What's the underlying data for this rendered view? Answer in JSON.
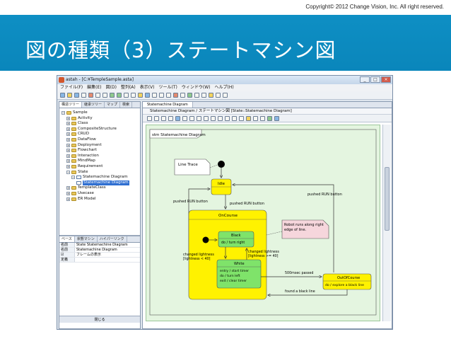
{
  "slide": {
    "copyright": "Copyright© 2012 Change Vision, Inc. All right reserved.",
    "title": "図の種類（3）ステートマシン図"
  },
  "window": {
    "title": "astah - [C:¥TempleSample.asta]",
    "controls": [
      "_",
      "□",
      "×"
    ],
    "menu": [
      "ファイル(F)",
      "編集(E)",
      "図(D)",
      "整列(A)",
      "表示(V)",
      "ツール(T)",
      "ウィンドウ(W)",
      "ヘルプ(H)"
    ]
  },
  "left_panel": {
    "tabs": [
      "構造ツリー",
      "継承ツリー",
      "マップ",
      "検索"
    ],
    "tree": [
      {
        "label": "Sample",
        "depth": 0,
        "icon": "project-icon",
        "expander": "−"
      },
      {
        "label": "Activity",
        "depth": 1,
        "icon": "folder-icon",
        "expander": "+"
      },
      {
        "label": "Class",
        "depth": 1,
        "icon": "folder-icon",
        "expander": "+"
      },
      {
        "label": "CompositeStructure",
        "depth": 1,
        "icon": "folder-icon",
        "expander": "+"
      },
      {
        "label": "CRUD",
        "depth": 1,
        "icon": "folder-icon",
        "expander": "+"
      },
      {
        "label": "DataFlow",
        "depth": 1,
        "icon": "folder-icon",
        "expander": "+"
      },
      {
        "label": "Deployment",
        "depth": 1,
        "icon": "folder-icon",
        "expander": "+"
      },
      {
        "label": "Flowchart",
        "depth": 1,
        "icon": "folder-icon",
        "expander": "+"
      },
      {
        "label": "Interaction",
        "depth": 1,
        "icon": "folder-icon",
        "expander": "+"
      },
      {
        "label": "MindMap",
        "depth": 1,
        "icon": "folder-icon",
        "expander": "+"
      },
      {
        "label": "Requirement",
        "depth": 1,
        "icon": "folder-icon",
        "expander": "+"
      },
      {
        "label": "State",
        "depth": 1,
        "icon": "folder-icon",
        "expander": "−"
      },
      {
        "label": "Statemachine Diagram",
        "depth": 2,
        "icon": "diagram-icon",
        "expander": "−"
      },
      {
        "label": "Statemachine Diagram",
        "depth": 3,
        "icon": "diagram-icon",
        "expander": "",
        "selected": true
      },
      {
        "label": "TemplateClass",
        "depth": 1,
        "icon": "folder-icon",
        "expander": "+"
      },
      {
        "label": "Usecase",
        "depth": 1,
        "icon": "folder-icon",
        "expander": "+"
      },
      {
        "label": "ER Model",
        "depth": 1,
        "icon": "folder-icon",
        "expander": "+"
      }
    ],
    "prop_tabs": [
      "ベース",
      "状態マシン",
      "ハイパーリンク"
    ],
    "props": [
      {
        "key": "名前",
        "value": "State Statemachine Diagram"
      },
      {
        "key": "名前",
        "value": "Statemachine Diagram"
      },
      {
        "key": "☑",
        "value": "フレームの表示"
      },
      {
        "key": "定義",
        "value": ""
      }
    ],
    "footer": "閉じる"
  },
  "diagram": {
    "tab": "Statemachine Diagram",
    "title": "Statemachine Diagram / ステートマシン図 [State::Statemachine Diagram]",
    "frame_label": "stm Statemachine Diagram",
    "note_line_trace": "Line Trace",
    "note_robot": [
      "Robot runs along right",
      "edge of line."
    ],
    "states": {
      "idle": "Idle",
      "oncourse": "OnCourse",
      "black": "Black",
      "black_action": "do / turn right",
      "white": "White",
      "white_actions": [
        "entry / start timer",
        "do / turn left",
        "exit / clear timer"
      ],
      "outofcourse": "OutOfCourse",
      "outofcourse_action": "do / explore a black line"
    },
    "transitions": {
      "pushed_run_right": "pushed RUN button",
      "pushed_run_left": "pushed RUN button",
      "pushed_run_mid": "pushed RUN button",
      "changed_left": [
        "changed lightness",
        "[lightness < 40]"
      ],
      "changed_right": [
        "changed lightness",
        "[lightness >= 40]"
      ],
      "msec": "500msec passed",
      "found": "found a black line"
    },
    "colors": {
      "canvas": "#e4f5e0",
      "state_yellow": "#fff200",
      "state_green": "#7fe36a",
      "note": "#f6d6dc"
    }
  }
}
